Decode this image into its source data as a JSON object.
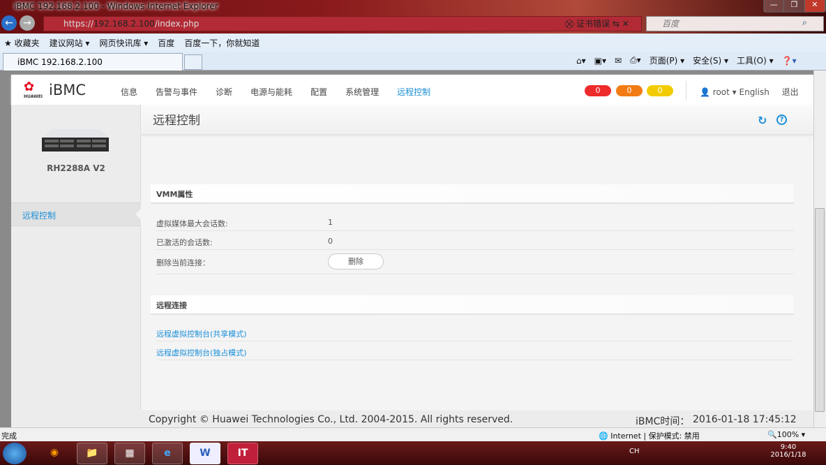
{
  "window": {
    "title": "iBMC 192.168.2.100 - Windows Internet Explorer",
    "buttons": [
      "—",
      "❐",
      "✕"
    ]
  },
  "browser": {
    "url_prefix": "https://",
    "url_host": "192.168.2.100",
    "url_path": "/index.php",
    "cert_error": "证书错误",
    "search_placeholder": "百度",
    "favorites": [
      "收藏夹",
      "建议网站 ▾",
      "网页快讯库 ▾",
      "百度",
      "百度一下，你就知道"
    ],
    "tab_title": "iBMC 192.168.2.100",
    "commands": [
      "页面(P) ▾",
      "安全(S) ▾",
      "工具(O) ▾"
    ]
  },
  "header": {
    "logo_text": "HUAWEI",
    "app": "iBMC",
    "nav": [
      "信息",
      "告警与事件",
      "诊断",
      "电源与能耗",
      "配置",
      "系统管理",
      "远程控制"
    ],
    "active_nav": "远程控制",
    "alarms": [
      {
        "count": "0",
        "color": "#ee2a2a"
      },
      {
        "count": "0",
        "color": "#f27c13"
      },
      {
        "count": "0",
        "color": "#f2cc00"
      }
    ],
    "user": "root",
    "language": "English",
    "logout": "退出"
  },
  "sidebar": {
    "model": "RH2288A V2",
    "items": [
      "远程控制"
    ]
  },
  "main": {
    "title": "远程控制",
    "vmm": {
      "header": "VMM属性",
      "rows": [
        {
          "label": "虚拟媒体最大会话数:",
          "value": "1"
        },
        {
          "label": "已激活的会话数:",
          "value": "0"
        },
        {
          "label": "删除当前连接：",
          "button": "删除"
        }
      ]
    },
    "remote": {
      "header": "远程连接",
      "links": [
        "远程虚拟控制台(共享模式)",
        "远程虚拟控制台(独占模式)"
      ]
    }
  },
  "footer": {
    "copyright": "Copyright © Huawei Technologies Co., Ltd. 2004-2015. All rights reserved.",
    "time_label": "iBMC时间：",
    "time": "2016-01-18 17:45:12"
  },
  "statusbar": {
    "status": "完成",
    "zone": "Internet | 保护模式: 禁用",
    "zoom": "100%"
  },
  "taskbar": {
    "lang": "CH",
    "time": "9:40",
    "date": "2016/1/18"
  },
  "colors": {
    "accent": "#1a8fd8"
  }
}
